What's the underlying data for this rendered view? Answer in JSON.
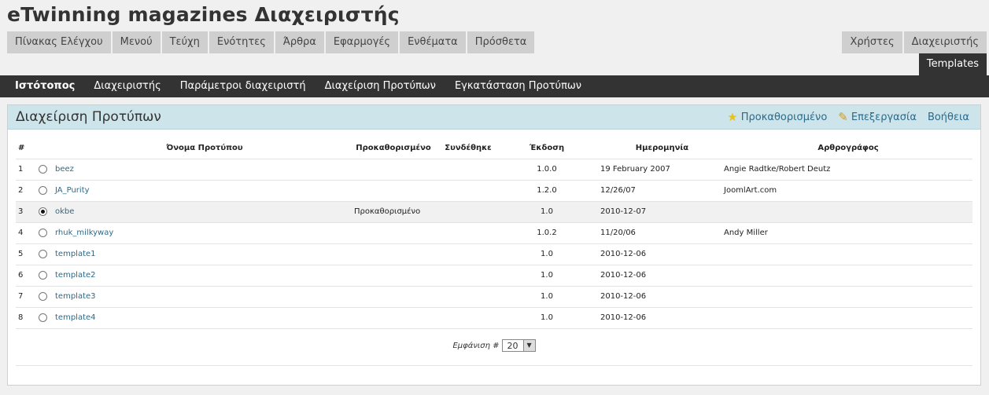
{
  "site": {
    "title": "eTwinning magazines Διαχειριστής"
  },
  "topnav_left": [
    "Πίνακας Ελέγχου",
    "Μενού",
    "Τεύχη",
    "Ενότητες",
    "Άρθρα",
    "Εφαρμογές",
    "Ενθέματα",
    "Πρόσθετα"
  ],
  "topnav_right": [
    "Χρήστες",
    "Διαχειριστής"
  ],
  "active_tab": "Templates",
  "subnav": [
    "Ιστότοπος",
    "Διαχειριστής",
    "Παράμετροι διαχειριστή",
    "Διαχείριση Προτύπων",
    "Εγκατάσταση Προτύπων"
  ],
  "panel": {
    "title": "Διαχείριση Προτύπων",
    "actions": {
      "default": "Προκαθορισμένο",
      "edit": "Επεξεργασία",
      "help": "Βοήθεια"
    }
  },
  "table": {
    "headers": {
      "num": "#",
      "name": "Όνομα Προτύπου",
      "default": "Προκαθορισμένο",
      "linked": "Συνδέθηκε",
      "version": "Έκδοση",
      "date": "Ημερομηνία",
      "author": "Αρθρογράφος"
    },
    "rows": [
      {
        "num": "1",
        "name": "beez",
        "default": "",
        "linked": "",
        "version": "1.0.0",
        "date": "19 February 2007",
        "author": "Angie Radtke/Robert Deutz",
        "selected": false
      },
      {
        "num": "2",
        "name": "JA_Purity",
        "default": "",
        "linked": "",
        "version": "1.2.0",
        "date": "12/26/07",
        "author": "JoomlArt.com",
        "selected": false
      },
      {
        "num": "3",
        "name": "okbe",
        "default": "Προκαθορισμένο",
        "linked": "",
        "version": "1.0",
        "date": "2010-12-07",
        "author": "",
        "selected": true
      },
      {
        "num": "4",
        "name": "rhuk_milkyway",
        "default": "",
        "linked": "",
        "version": "1.0.2",
        "date": "11/20/06",
        "author": "Andy Miller",
        "selected": false
      },
      {
        "num": "5",
        "name": "template1",
        "default": "",
        "linked": "",
        "version": "1.0",
        "date": "2010-12-06",
        "author": "",
        "selected": false
      },
      {
        "num": "6",
        "name": "template2",
        "default": "",
        "linked": "",
        "version": "1.0",
        "date": "2010-12-06",
        "author": "",
        "selected": false
      },
      {
        "num": "7",
        "name": "template3",
        "default": "",
        "linked": "",
        "version": "1.0",
        "date": "2010-12-06",
        "author": "",
        "selected": false
      },
      {
        "num": "8",
        "name": "template4",
        "default": "",
        "linked": "",
        "version": "1.0",
        "date": "2010-12-06",
        "author": "",
        "selected": false
      }
    ]
  },
  "pager": {
    "label": "Εμφάνιση #",
    "value": "20"
  },
  "icons": {
    "default": "star-icon",
    "edit": "pencil-icon",
    "select_arrow": "chevron-down-icon"
  },
  "colors": {
    "subnav_bg": "#333333",
    "header_bg": "#cde4ea",
    "link": "#2b6a8a"
  }
}
